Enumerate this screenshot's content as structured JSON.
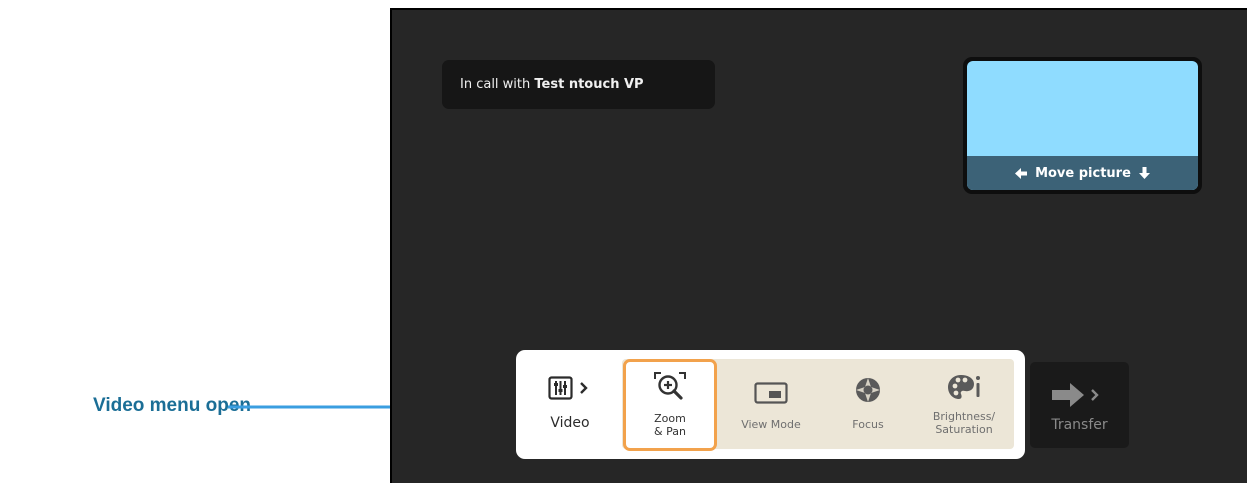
{
  "annotation": {
    "label": "Video menu open",
    "color": "#1b6e96",
    "arrow_color": "#3a9ee0"
  },
  "call": {
    "prefix": "In call with",
    "name": "Test ntouch VP"
  },
  "self_view": {
    "move_label": "Move picture",
    "icons": [
      "arrow-left-icon",
      "arrow-down-icon"
    ]
  },
  "menu": {
    "video": {
      "label": "Video",
      "icon": "sliders-icon"
    },
    "items": [
      {
        "label_line1": "Zoom",
        "label_line2": "& Pan",
        "icon": "zoom-pan-icon",
        "selected": true
      },
      {
        "label": "View Mode",
        "icon": "view-mode-icon"
      },
      {
        "label": "Focus",
        "icon": "aperture-icon"
      },
      {
        "label_line1": "Brightness/",
        "label_line2": "Saturation",
        "icon": "palette-icon"
      }
    ],
    "transfer": {
      "label": "Transfer",
      "icon": "transfer-arrow-icon"
    }
  },
  "colors": {
    "screen_bg": "#262626",
    "selection_border": "#f2a24c",
    "self_view_bg": "#8fdcff",
    "move_bar_bg": "#3c6277",
    "sub_panel_bg": "#ece6d7"
  }
}
